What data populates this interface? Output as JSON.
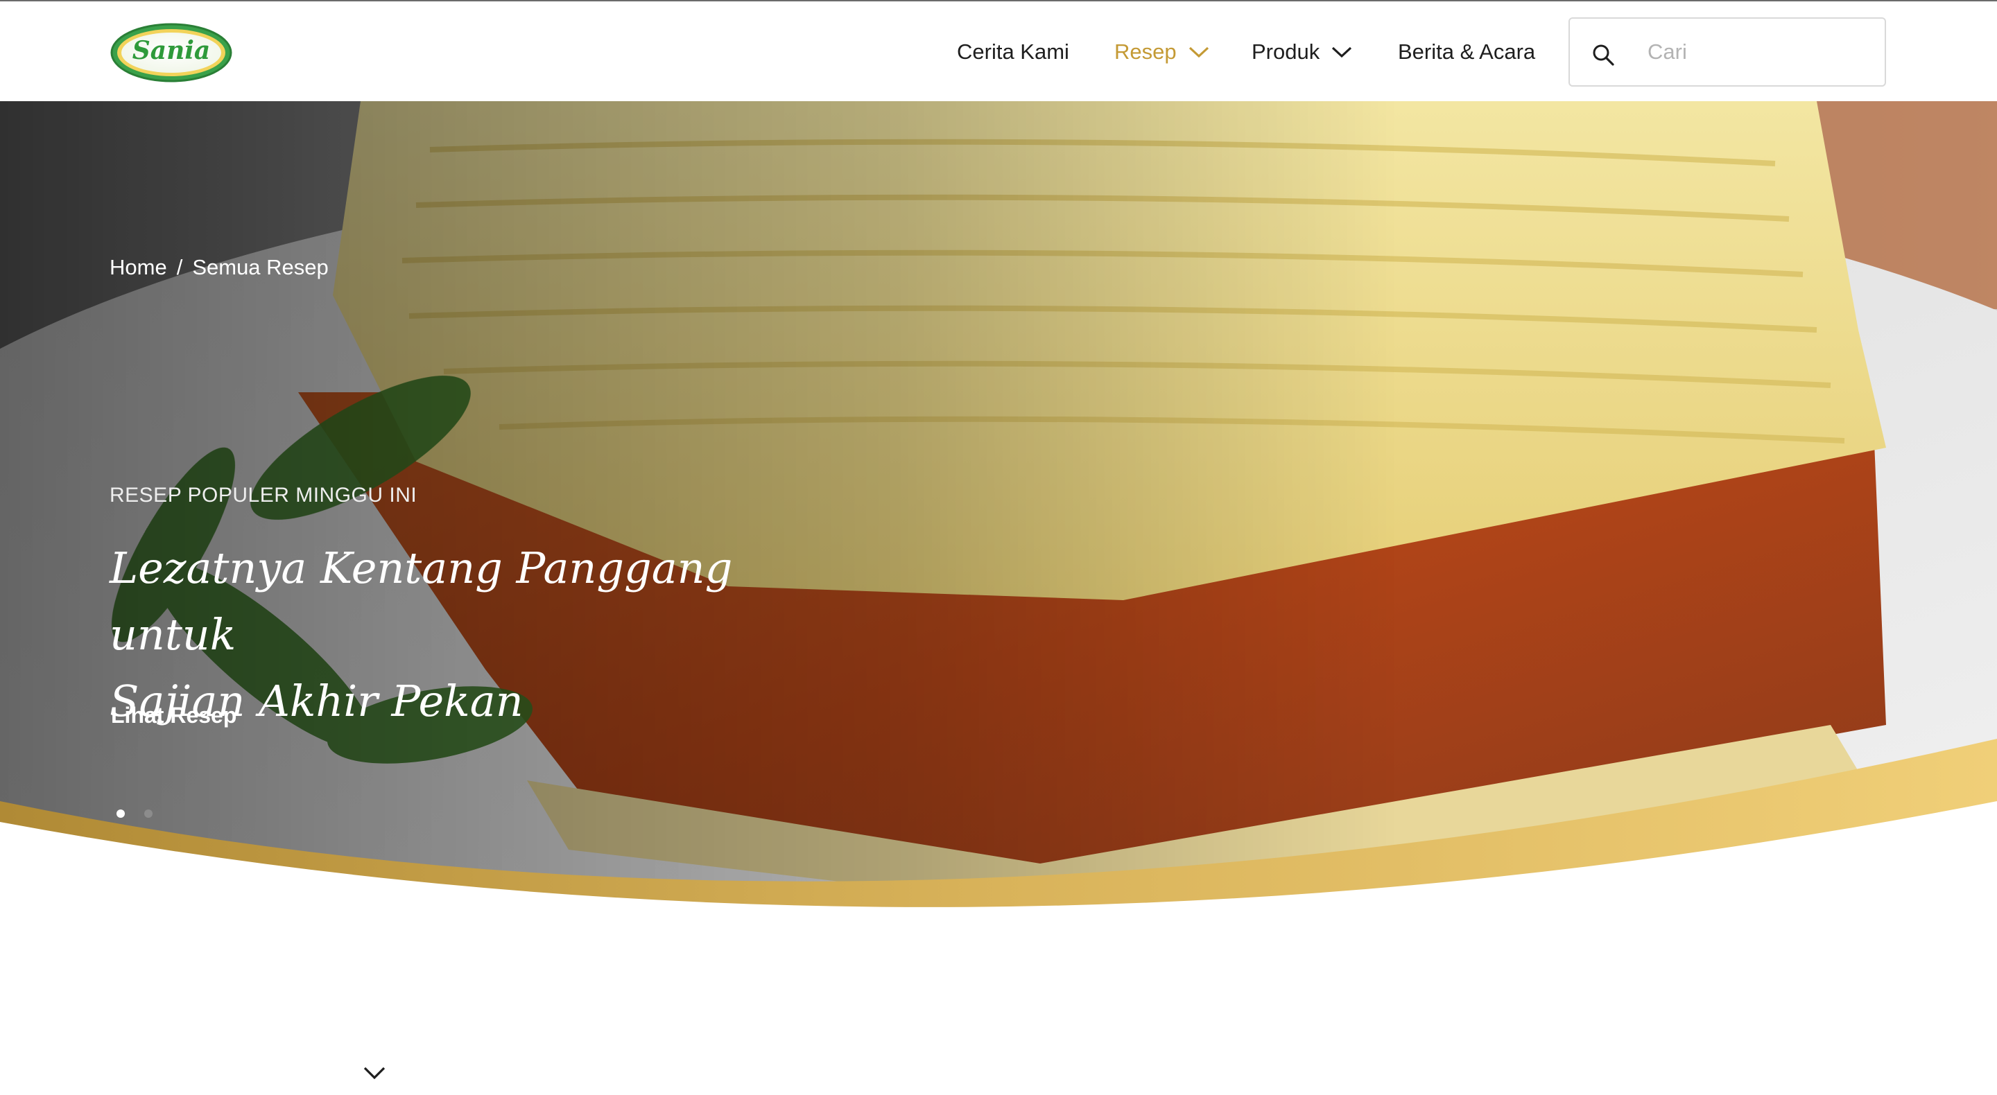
{
  "brand": {
    "logo_text": "Sania",
    "accent_color": "#c49a35",
    "logo_green": "#2e9a3a"
  },
  "nav": {
    "items": [
      {
        "label": "Cerita Kami",
        "dropdown": false,
        "active": false
      },
      {
        "label": "Resep",
        "dropdown": true,
        "active": true
      },
      {
        "label": "Produk",
        "dropdown": true,
        "active": false
      },
      {
        "label": "Berita & Acara",
        "dropdown": false,
        "active": false
      }
    ]
  },
  "search": {
    "placeholder": "Cari",
    "value": ""
  },
  "breadcrumb": {
    "home": "Home",
    "separator": "/",
    "current": "Semua Resep"
  },
  "hero": {
    "eyebrow": "RESEP POPULER MINGGU INI",
    "title_line1": "Lezatnya Kentang Panggang untuk",
    "title_line2": "Sajian Akhir Pekan",
    "cta": "Lihat Resep",
    "slides_total": 2,
    "active_slide": 1
  },
  "icons": {
    "search": "search-icon",
    "dropdown": "chevron-down-icon",
    "scroll": "chevron-down-icon"
  }
}
